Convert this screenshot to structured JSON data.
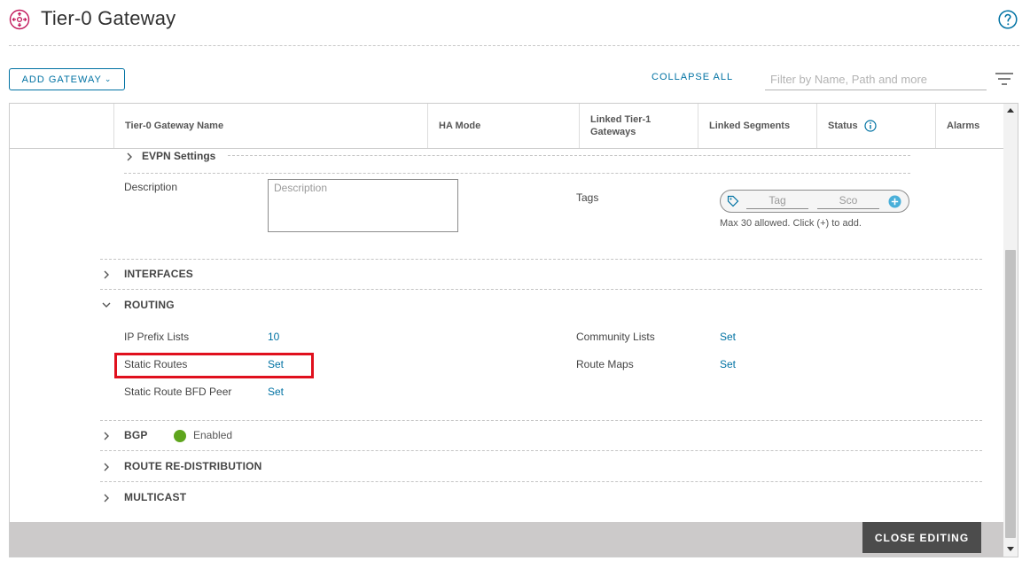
{
  "header": {
    "title": "Tier-0 Gateway",
    "icon": "tier0-gateway-icon",
    "help_icon": "help-icon"
  },
  "toolbar": {
    "add_gateway_label": "ADD GATEWAY",
    "collapse_all_label": "COLLAPSE ALL",
    "filter_placeholder": "Filter by Name, Path and more",
    "filter_value": ""
  },
  "grid": {
    "columns": [
      "Tier-0 Gateway Name",
      "HA Mode",
      "Linked Tier-1 Gateways",
      "Linked Segments",
      "Status",
      "Alarms"
    ]
  },
  "evpn": {
    "label": "EVPN Settings"
  },
  "description": {
    "label": "Description",
    "placeholder": "Description",
    "value": ""
  },
  "tags": {
    "label": "Tags",
    "tag_placeholder": "Tag",
    "scope_placeholder": "Sco",
    "hint": "Max 30 allowed. Click (+) to add."
  },
  "sections": {
    "interfaces": "INTERFACES",
    "routing": "ROUTING",
    "bgp": "BGP",
    "route_redistribution": "ROUTE RE-DISTRIBUTION",
    "multicast": "MULTICAST"
  },
  "routing": {
    "ip_prefix_lists": {
      "label": "IP Prefix Lists",
      "value": "10"
    },
    "static_routes": {
      "label": "Static Routes",
      "value": "Set"
    },
    "static_route_bfd_peer": {
      "label": "Static Route BFD Peer",
      "value": "Set"
    },
    "community_lists": {
      "label": "Community Lists",
      "value": "Set"
    },
    "route_maps": {
      "label": "Route Maps",
      "value": "Set"
    }
  },
  "bgp": {
    "status": "Enabled",
    "status_color": "#5ea51d"
  },
  "footer": {
    "close_editing_label": "CLOSE EDITING"
  },
  "colors": {
    "accent": "#0072a3",
    "highlight": "#e0101d",
    "footer_bar": "#cccaca",
    "close_button": "#4c4c4c"
  }
}
